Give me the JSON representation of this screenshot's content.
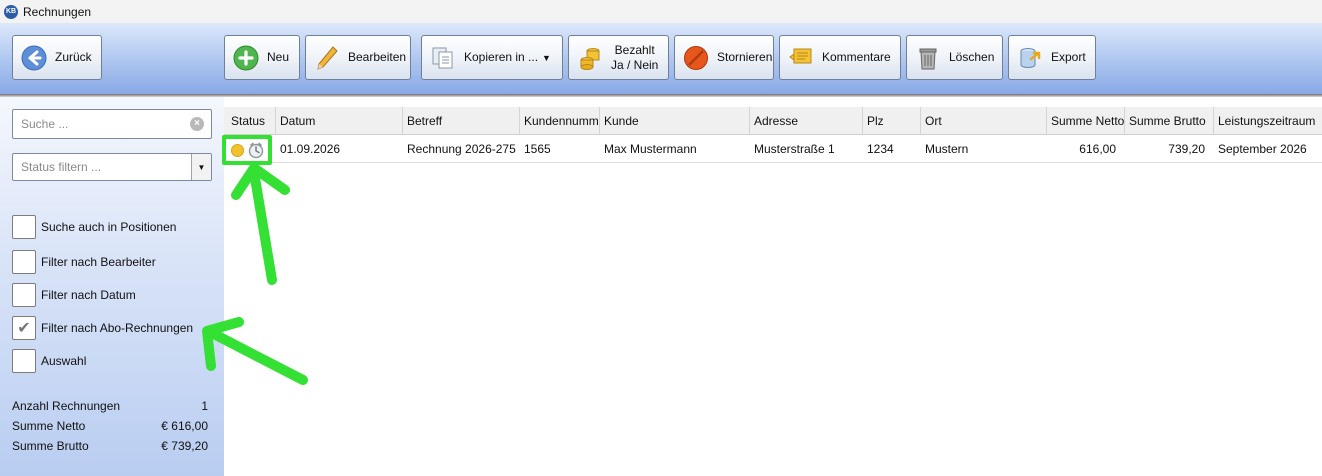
{
  "window": {
    "title": "Rechnungen",
    "logo_text": "KB"
  },
  "toolbar": {
    "back": "Zurück",
    "new": "Neu",
    "edit": "Bearbeiten",
    "copy": "Kopieren in ...",
    "paid_line1": "Bezahlt",
    "paid_line2": "Ja / Nein",
    "cancel": "Stornieren",
    "comments": "Kommentare",
    "delete": "Löschen",
    "export": "Export"
  },
  "sidebar": {
    "search_placeholder": "Suche ...",
    "status_filter_placeholder": "Status filtern ...",
    "checkboxes": [
      {
        "label": "Suche auch in Positionen",
        "checked": false
      },
      {
        "label": "Filter nach Bearbeiter",
        "checked": false
      },
      {
        "label": "Filter nach Datum",
        "checked": false
      },
      {
        "label": "Filter nach Abo-Rechnungen",
        "checked": true
      },
      {
        "label": "Auswahl",
        "checked": false
      }
    ],
    "stats": [
      {
        "label": "Anzahl Rechnungen",
        "value": "1"
      },
      {
        "label": "Summe Netto",
        "value": "€ 616,00"
      },
      {
        "label": "Summe Brutto",
        "value": "€ 739,20"
      }
    ]
  },
  "table": {
    "columns": [
      "Status",
      "Datum",
      "Betreff",
      "Kundennummer",
      "Kunde",
      "Adresse",
      "Plz",
      "Ort",
      "Summe Netto",
      "Summe Brutto",
      "Leistungszeitraum"
    ],
    "rows": [
      {
        "status_color": "#f2c12e",
        "status_icon": "clock-icon",
        "cells": [
          "01.09.2026",
          "Rechnung 2026-275",
          "1565",
          "Max Mustermann",
          "Musterstraße 1",
          "1234",
          "Mustern",
          "616,00",
          "739,20",
          "September 2026"
        ]
      }
    ]
  },
  "colors": {
    "annotation": "#33e033",
    "toolbar_top": "#dde8fb",
    "toolbar_bottom": "#88a9e6"
  }
}
